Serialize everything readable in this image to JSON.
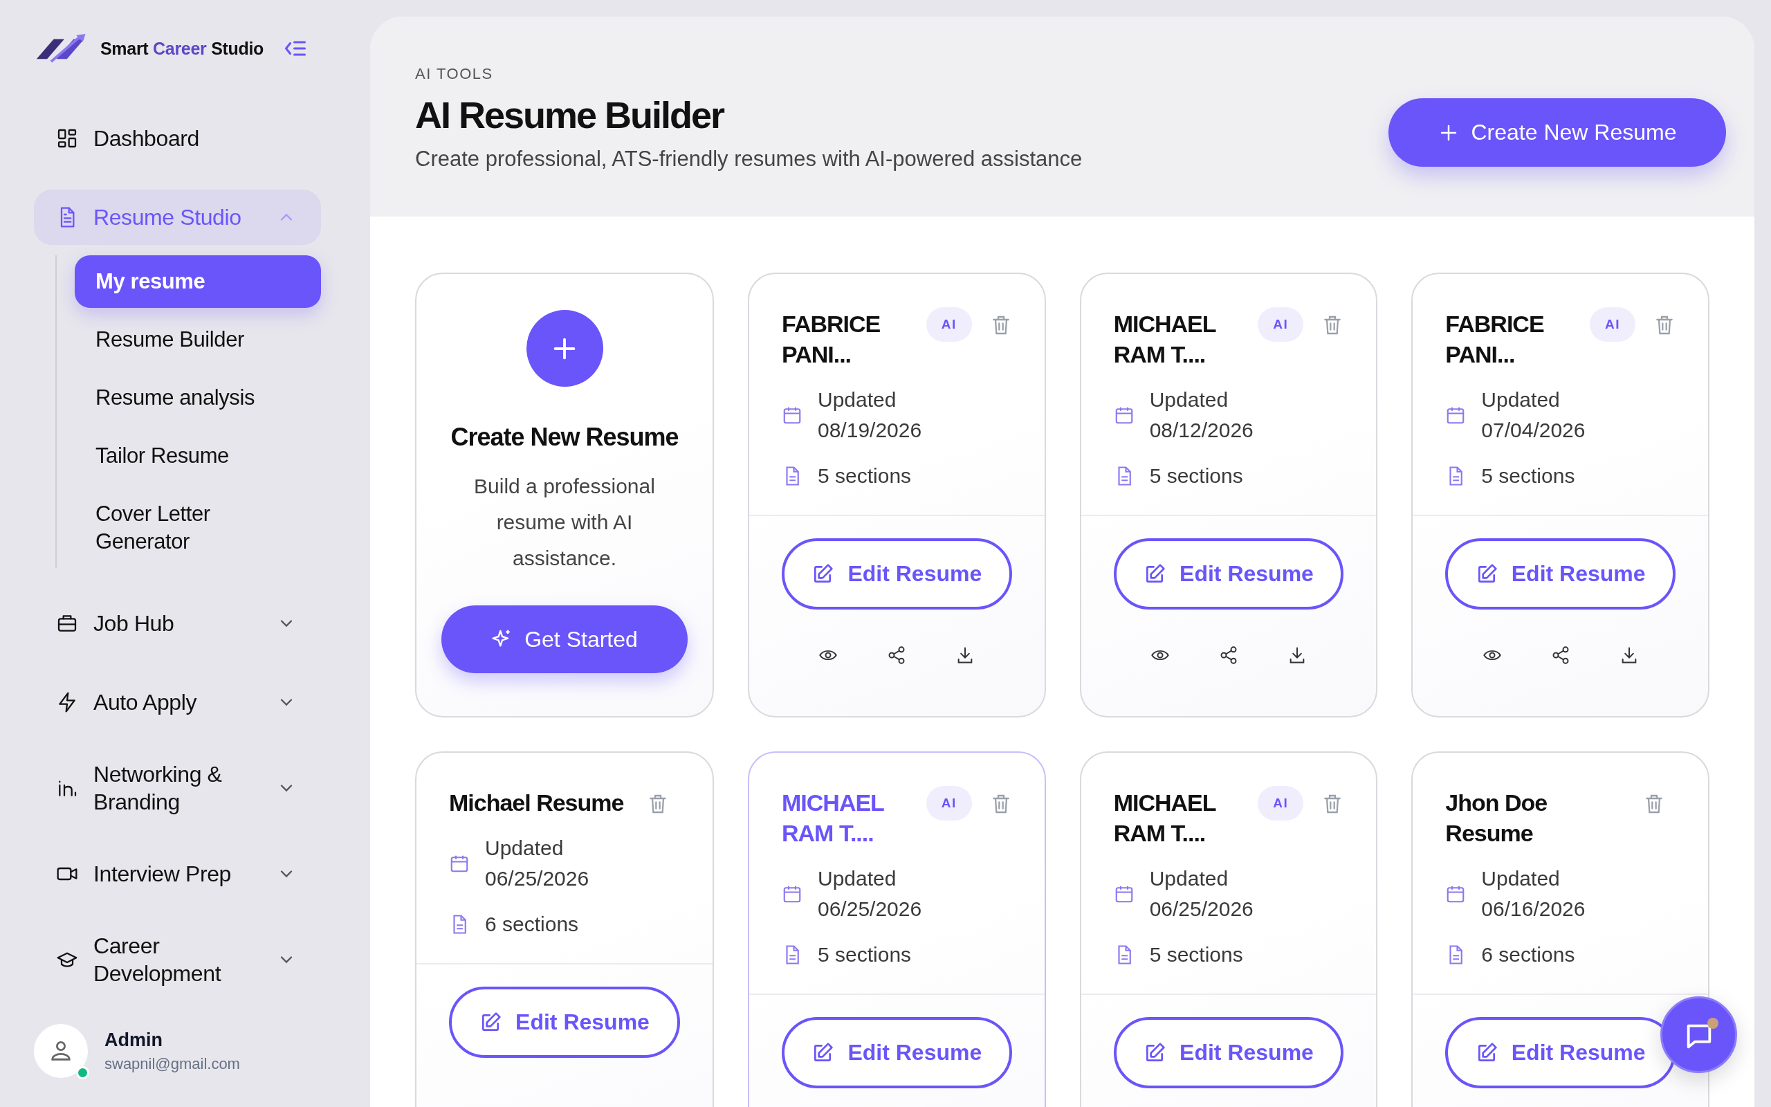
{
  "brand": {
    "parts": [
      {
        "text": "Smart",
        "accent": false
      },
      {
        "text": "Career",
        "accent": true
      },
      {
        "text": "Studio",
        "accent": false
      }
    ]
  },
  "sidebar": {
    "items": [
      {
        "label": "Dashboard",
        "kind": "link",
        "selected": false
      },
      {
        "label": "Resume Studio",
        "kind": "group",
        "selected": true,
        "expanded": true,
        "children": [
          {
            "label": "My resume",
            "selected": true
          },
          {
            "label": "Resume Builder",
            "selected": false
          },
          {
            "label": "Resume analysis",
            "selected": false
          },
          {
            "label": "Tailor Resume",
            "selected": false
          },
          {
            "label": "Cover Letter Generator",
            "selected": false
          }
        ]
      },
      {
        "label": "Job Hub",
        "kind": "group",
        "selected": false,
        "expanded": false
      },
      {
        "label": "Auto Apply",
        "kind": "group",
        "selected": false,
        "expanded": false
      },
      {
        "label": "Networking & Branding",
        "kind": "group",
        "selected": false,
        "expanded": false
      },
      {
        "label": "Interview Prep",
        "kind": "group",
        "selected": false,
        "expanded": false
      },
      {
        "label": "Career Development",
        "kind": "group",
        "selected": false,
        "expanded": false
      }
    ]
  },
  "user": {
    "name": "Admin",
    "email": "swapnil@gmail.com",
    "online": true
  },
  "header": {
    "eyebrow": "AI TOOLS",
    "title": "AI Resume Builder",
    "subtitle": "Create professional, ATS-friendly resumes with AI-powered assistance",
    "button": "Create New Resume"
  },
  "cards": [
    {
      "kind": "create",
      "title": "Create New Resume",
      "description": "Build a professional resume with AI assistance.",
      "button": "Get Started"
    },
    {
      "kind": "resume",
      "name": "FABRICE PANI...",
      "badge": "AI",
      "selected": false,
      "updated": "Updated 08/19/2026",
      "sections": "5 sections",
      "button": "Edit Resume",
      "actions": true
    },
    {
      "kind": "resume",
      "name": "MICHAEL RAM T....",
      "badge": "AI",
      "selected": false,
      "updated": "Updated 08/12/2026",
      "sections": "5 sections",
      "button": "Edit Resume",
      "actions": true
    },
    {
      "kind": "resume",
      "name": "FABRICE PANI...",
      "badge": "AI",
      "selected": false,
      "updated": "Updated 07/04/2026",
      "sections": "5 sections",
      "button": "Edit Resume",
      "actions": true
    },
    {
      "kind": "resume",
      "name": "Michael Resume",
      "selected": false,
      "updated": "Updated 06/25/2026",
      "sections": "6 sections",
      "button": "Edit Resume"
    },
    {
      "kind": "resume",
      "name": "MICHAEL RAM T....",
      "badge": "AI",
      "selected": true,
      "updated": "Updated 06/25/2026",
      "sections": "5 sections",
      "button": "Edit Resume"
    },
    {
      "kind": "resume",
      "name": "MICHAEL RAM T....",
      "badge": "AI",
      "selected": false,
      "updated": "Updated 06/25/2026",
      "sections": "5 sections",
      "button": "Edit Resume"
    },
    {
      "kind": "resume",
      "name": "Jhon Doe Resume",
      "selected": false,
      "updated": "Updated 06/16/2026",
      "sections": "6 sections",
      "button": "Edit Resume"
    }
  ],
  "chat_button": {
    "notification": true
  }
}
